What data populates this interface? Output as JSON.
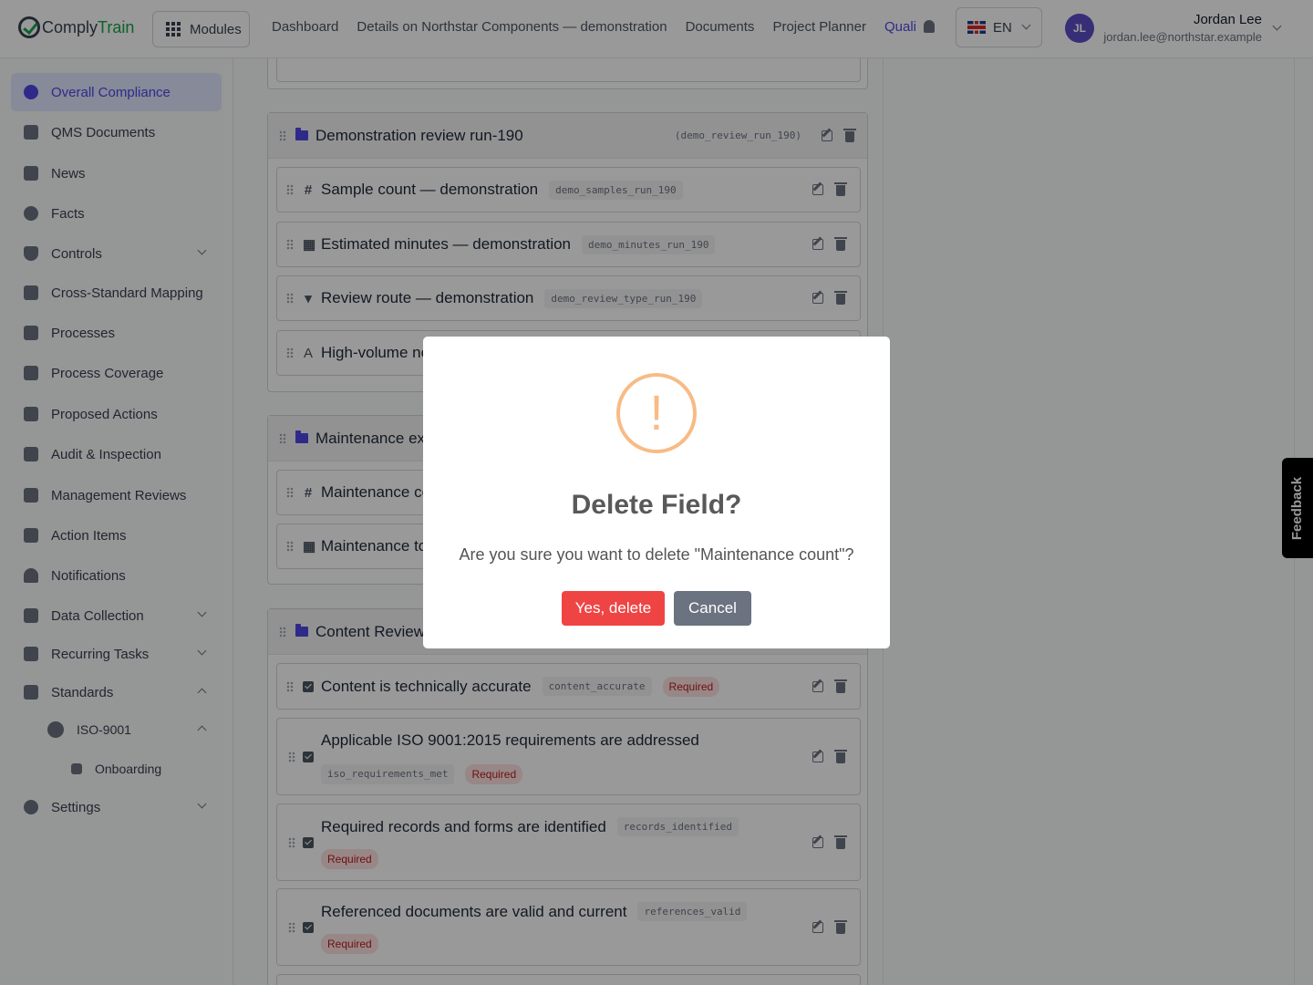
{
  "app": {
    "brand_part1": "Comply",
    "brand_part2": "Train"
  },
  "header": {
    "modules_label": "Modules",
    "nav": [
      "Dashboard",
      "Details on Northstar Components — demonstration",
      "Documents",
      "Project Planner",
      "Quali"
    ],
    "language": "EN",
    "avatar_initials": "JL",
    "user_name": "Jordan Lee",
    "user_email": "jordan.lee@northstar.example"
  },
  "sidebar": {
    "items": [
      "Overall Compliance",
      "QMS Documents",
      "News",
      "Facts",
      "Controls",
      "Cross-Standard Mapping",
      "Processes",
      "Process Coverage",
      "Proposed Actions",
      "Audit & Inspection",
      "Management Reviews",
      "Action Items",
      "Notifications",
      "Data Collection",
      "Recurring Tasks",
      "Standards",
      "ISO-9001",
      "Onboarding",
      "Settings"
    ]
  },
  "main": {
    "groups": [
      {
        "title": "Demonstration review run-190",
        "key": "(demo_review_run_190)",
        "fields": [
          {
            "type_icon": "#",
            "title": "Sample count — demonstration",
            "key": "demo_samples_run_190"
          },
          {
            "type_icon": "▦",
            "title": "Estimated minutes — demonstration",
            "key": "demo_minutes_run_190"
          },
          {
            "type_icon": "▾",
            "title": "Review route — demonstration",
            "key": "demo_review_type_run_190"
          },
          {
            "type_icon": "A",
            "title": "High-volume no"
          }
        ]
      },
      {
        "title": "Maintenance ex",
        "fields": [
          {
            "type_icon": "#",
            "title": "Maintenance co"
          },
          {
            "type_icon": "▦",
            "title": "Maintenance to"
          }
        ]
      },
      {
        "title": "Content Review",
        "fields": [
          {
            "title": "Content is technically accurate",
            "key": "content_accurate",
            "badge": "Required"
          },
          {
            "title": "Applicable ISO 9001:2015 requirements are addressed",
            "key": "iso_requirements_met",
            "badge": "Required"
          },
          {
            "title": "Required records and forms are identified",
            "key": "records_identified",
            "badge": "Required"
          },
          {
            "title": "Referenced documents are valid and current",
            "key": "references_valid",
            "badge": "Required"
          }
        ]
      }
    ]
  },
  "feedback_label": "Feedback",
  "modal": {
    "icon_glyph": "!",
    "title": "Delete Field?",
    "text": "Are you sure you want to delete \"Maintenance count\"?",
    "confirm_label": "Yes, delete",
    "cancel_label": "Cancel"
  },
  "colors": {
    "accent": "#4f46e5",
    "danger": "#ef4444",
    "warning": "#f8bb86",
    "brand_green": "#16a34a"
  }
}
